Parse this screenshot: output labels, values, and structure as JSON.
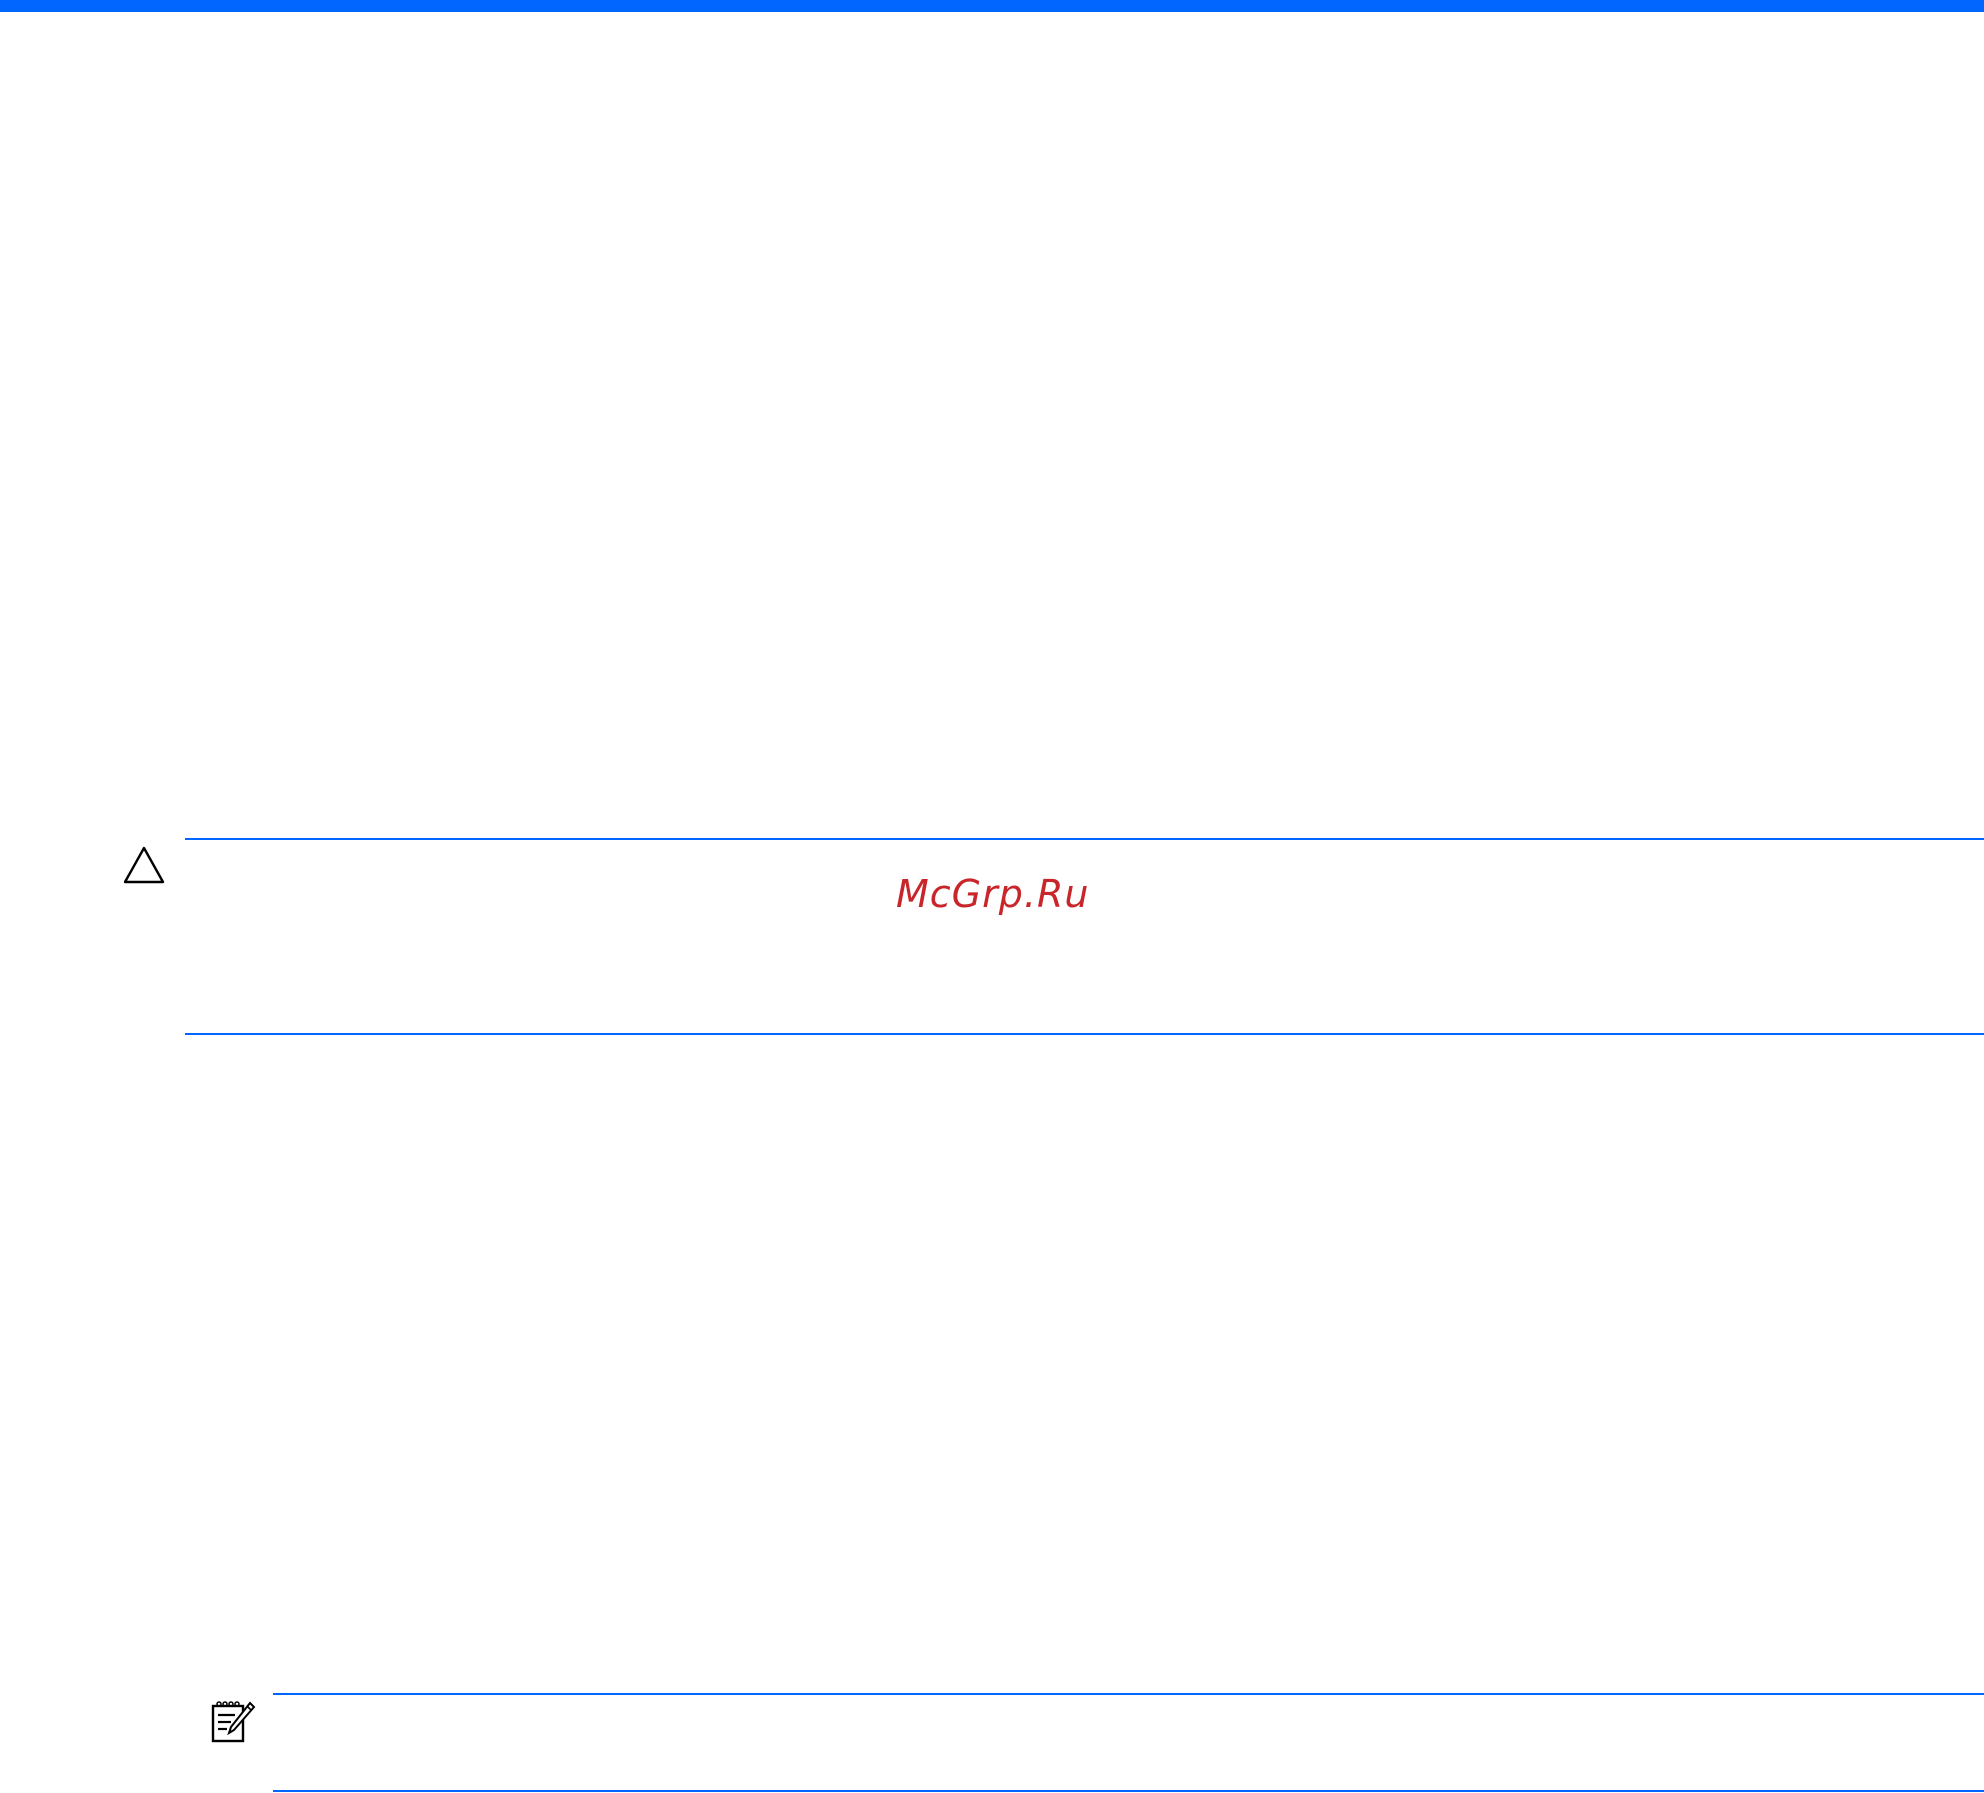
{
  "page": {
    "accent_color": "#0066ff",
    "background_color": "#ffffff"
  },
  "caution_block": {
    "icon": "caution-triangle-icon"
  },
  "note_block": {
    "icon": "note-pad-pencil-icon"
  },
  "watermark": {
    "text": "McGrp.Ru",
    "color": "#c8262a"
  }
}
